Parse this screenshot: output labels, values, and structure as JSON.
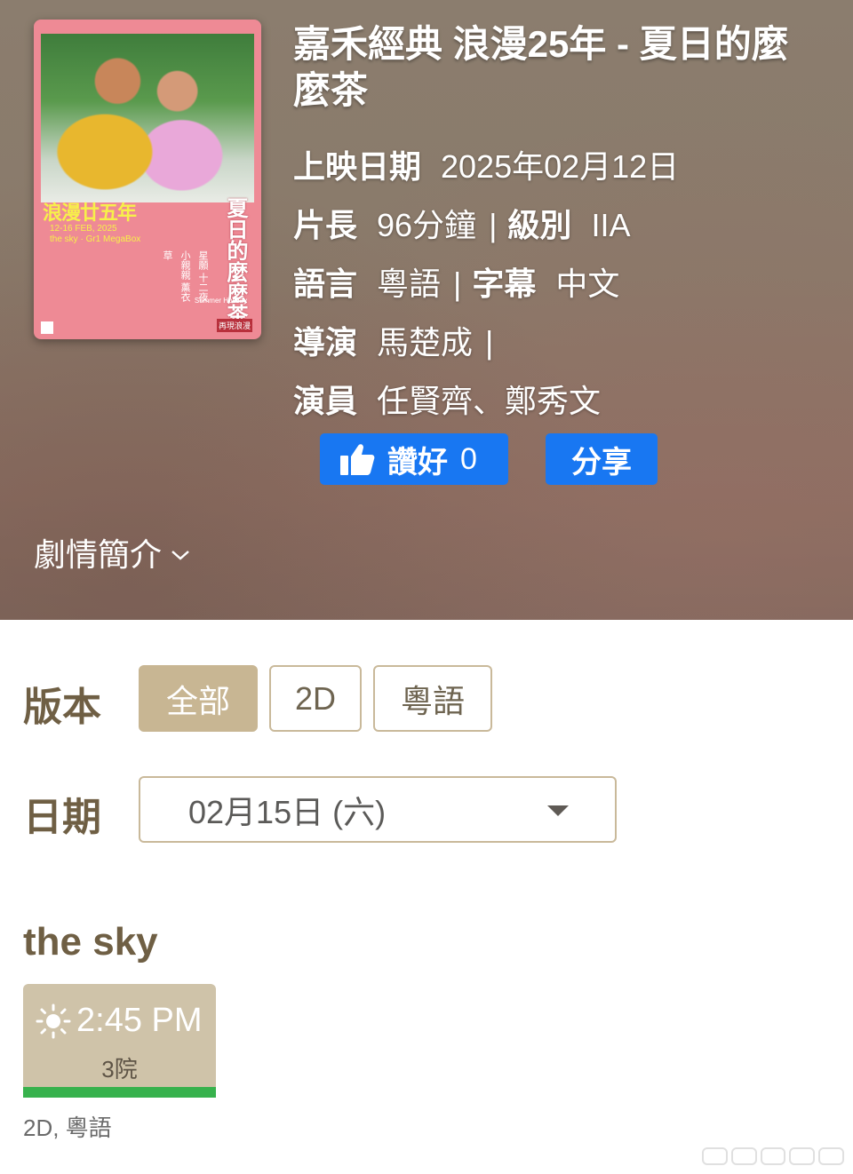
{
  "movie": {
    "title": "嘉禾經典 浪漫25年 - 夏日的麼麼茶",
    "release_label": "上映日期",
    "release_value": "2025年02月12日",
    "duration_label": "片長",
    "duration_value": "96分鐘",
    "rating_label": "級別",
    "rating_value": "IIA",
    "language_label": "語言",
    "language_value": "粵語",
    "subtitle_label": "字幕",
    "subtitle_value": "中文",
    "director_label": "導演",
    "director_value": "馬楚成",
    "cast_label": "演員",
    "cast_value": "任賢齊、鄭秀文",
    "separator": "|"
  },
  "poster": {
    "title_text": "浪漫廿五年",
    "date_text": "12-16 FEB, 2025",
    "venue_text": "the sky · Gr1 MegaBox",
    "vertical_title": "夏日的麼麼茶",
    "credits_text": "星願 十二夜 小親親 薰衣草",
    "english_title": "Summer Holiday",
    "tag_text": "再現浪漫"
  },
  "actions": {
    "like_label": "讚好",
    "like_count": "0",
    "share_label": "分享",
    "like_color": "#1877f2"
  },
  "synopsis": {
    "label": "劇情簡介"
  },
  "filters": {
    "version_label": "版本",
    "version_options": [
      "全部",
      "2D",
      "粵語"
    ],
    "selected_version": "全部",
    "date_label": "日期",
    "date_value": "02月15日 (六)"
  },
  "showtimes": {
    "cinema": "the sky",
    "sessions": [
      {
        "time": "2:45 PM",
        "house": "3院",
        "format": "2D, 粵語",
        "icon": "sun-icon"
      }
    ]
  },
  "colors": {
    "accent": "#c8b693",
    "heading": "#6f5f44",
    "availability_bar": "#37b24d"
  }
}
